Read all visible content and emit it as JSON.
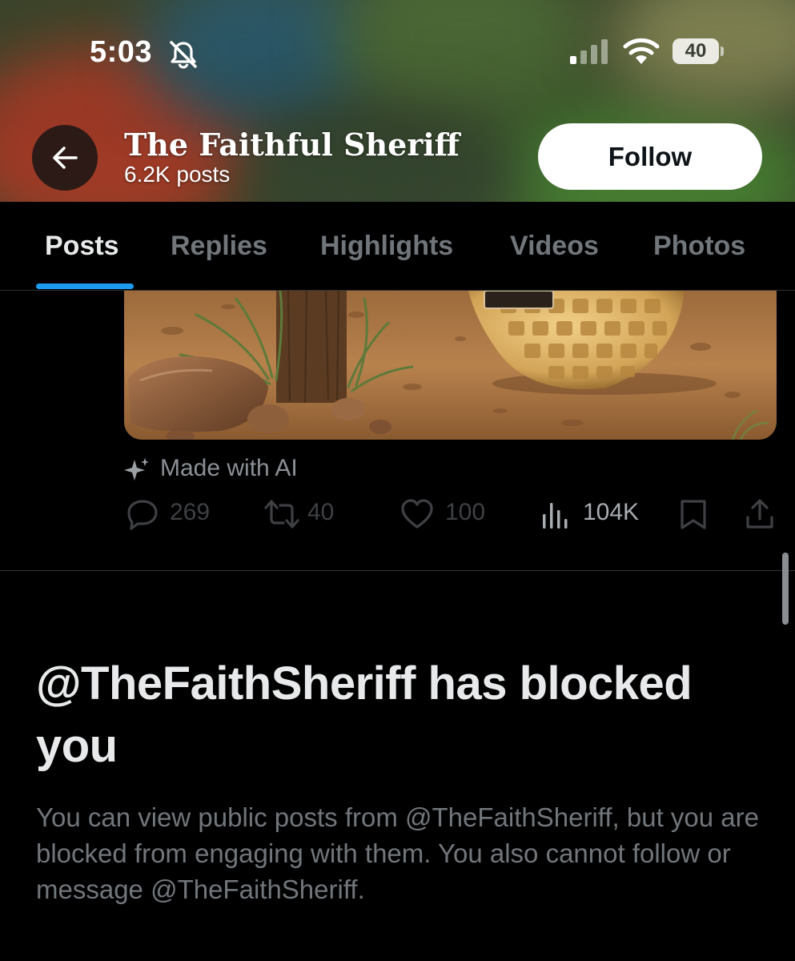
{
  "status_bar": {
    "time": "5:03",
    "battery": "40"
  },
  "header": {
    "name": "The Faithful Sheriff",
    "post_count": "6.2K posts",
    "follow_label": "Follow"
  },
  "tabs": [
    "Posts",
    "Replies",
    "Highlights",
    "Videos",
    "Photos"
  ],
  "active_tab": "Posts",
  "post": {
    "ai_label": "Made with AI",
    "replies": "269",
    "reposts": "40",
    "likes": "100",
    "views": "104K"
  },
  "blocked": {
    "title": "@TheFaithSheriff has blocked you",
    "description": "You can view public posts from @TheFaithSheriff, but you are blocked from engaging with them. You also cannot follow or message @TheFaithSheriff."
  },
  "colors": {
    "accent": "#1d9bf0",
    "background": "#000000",
    "muted_text": "#71767b"
  }
}
